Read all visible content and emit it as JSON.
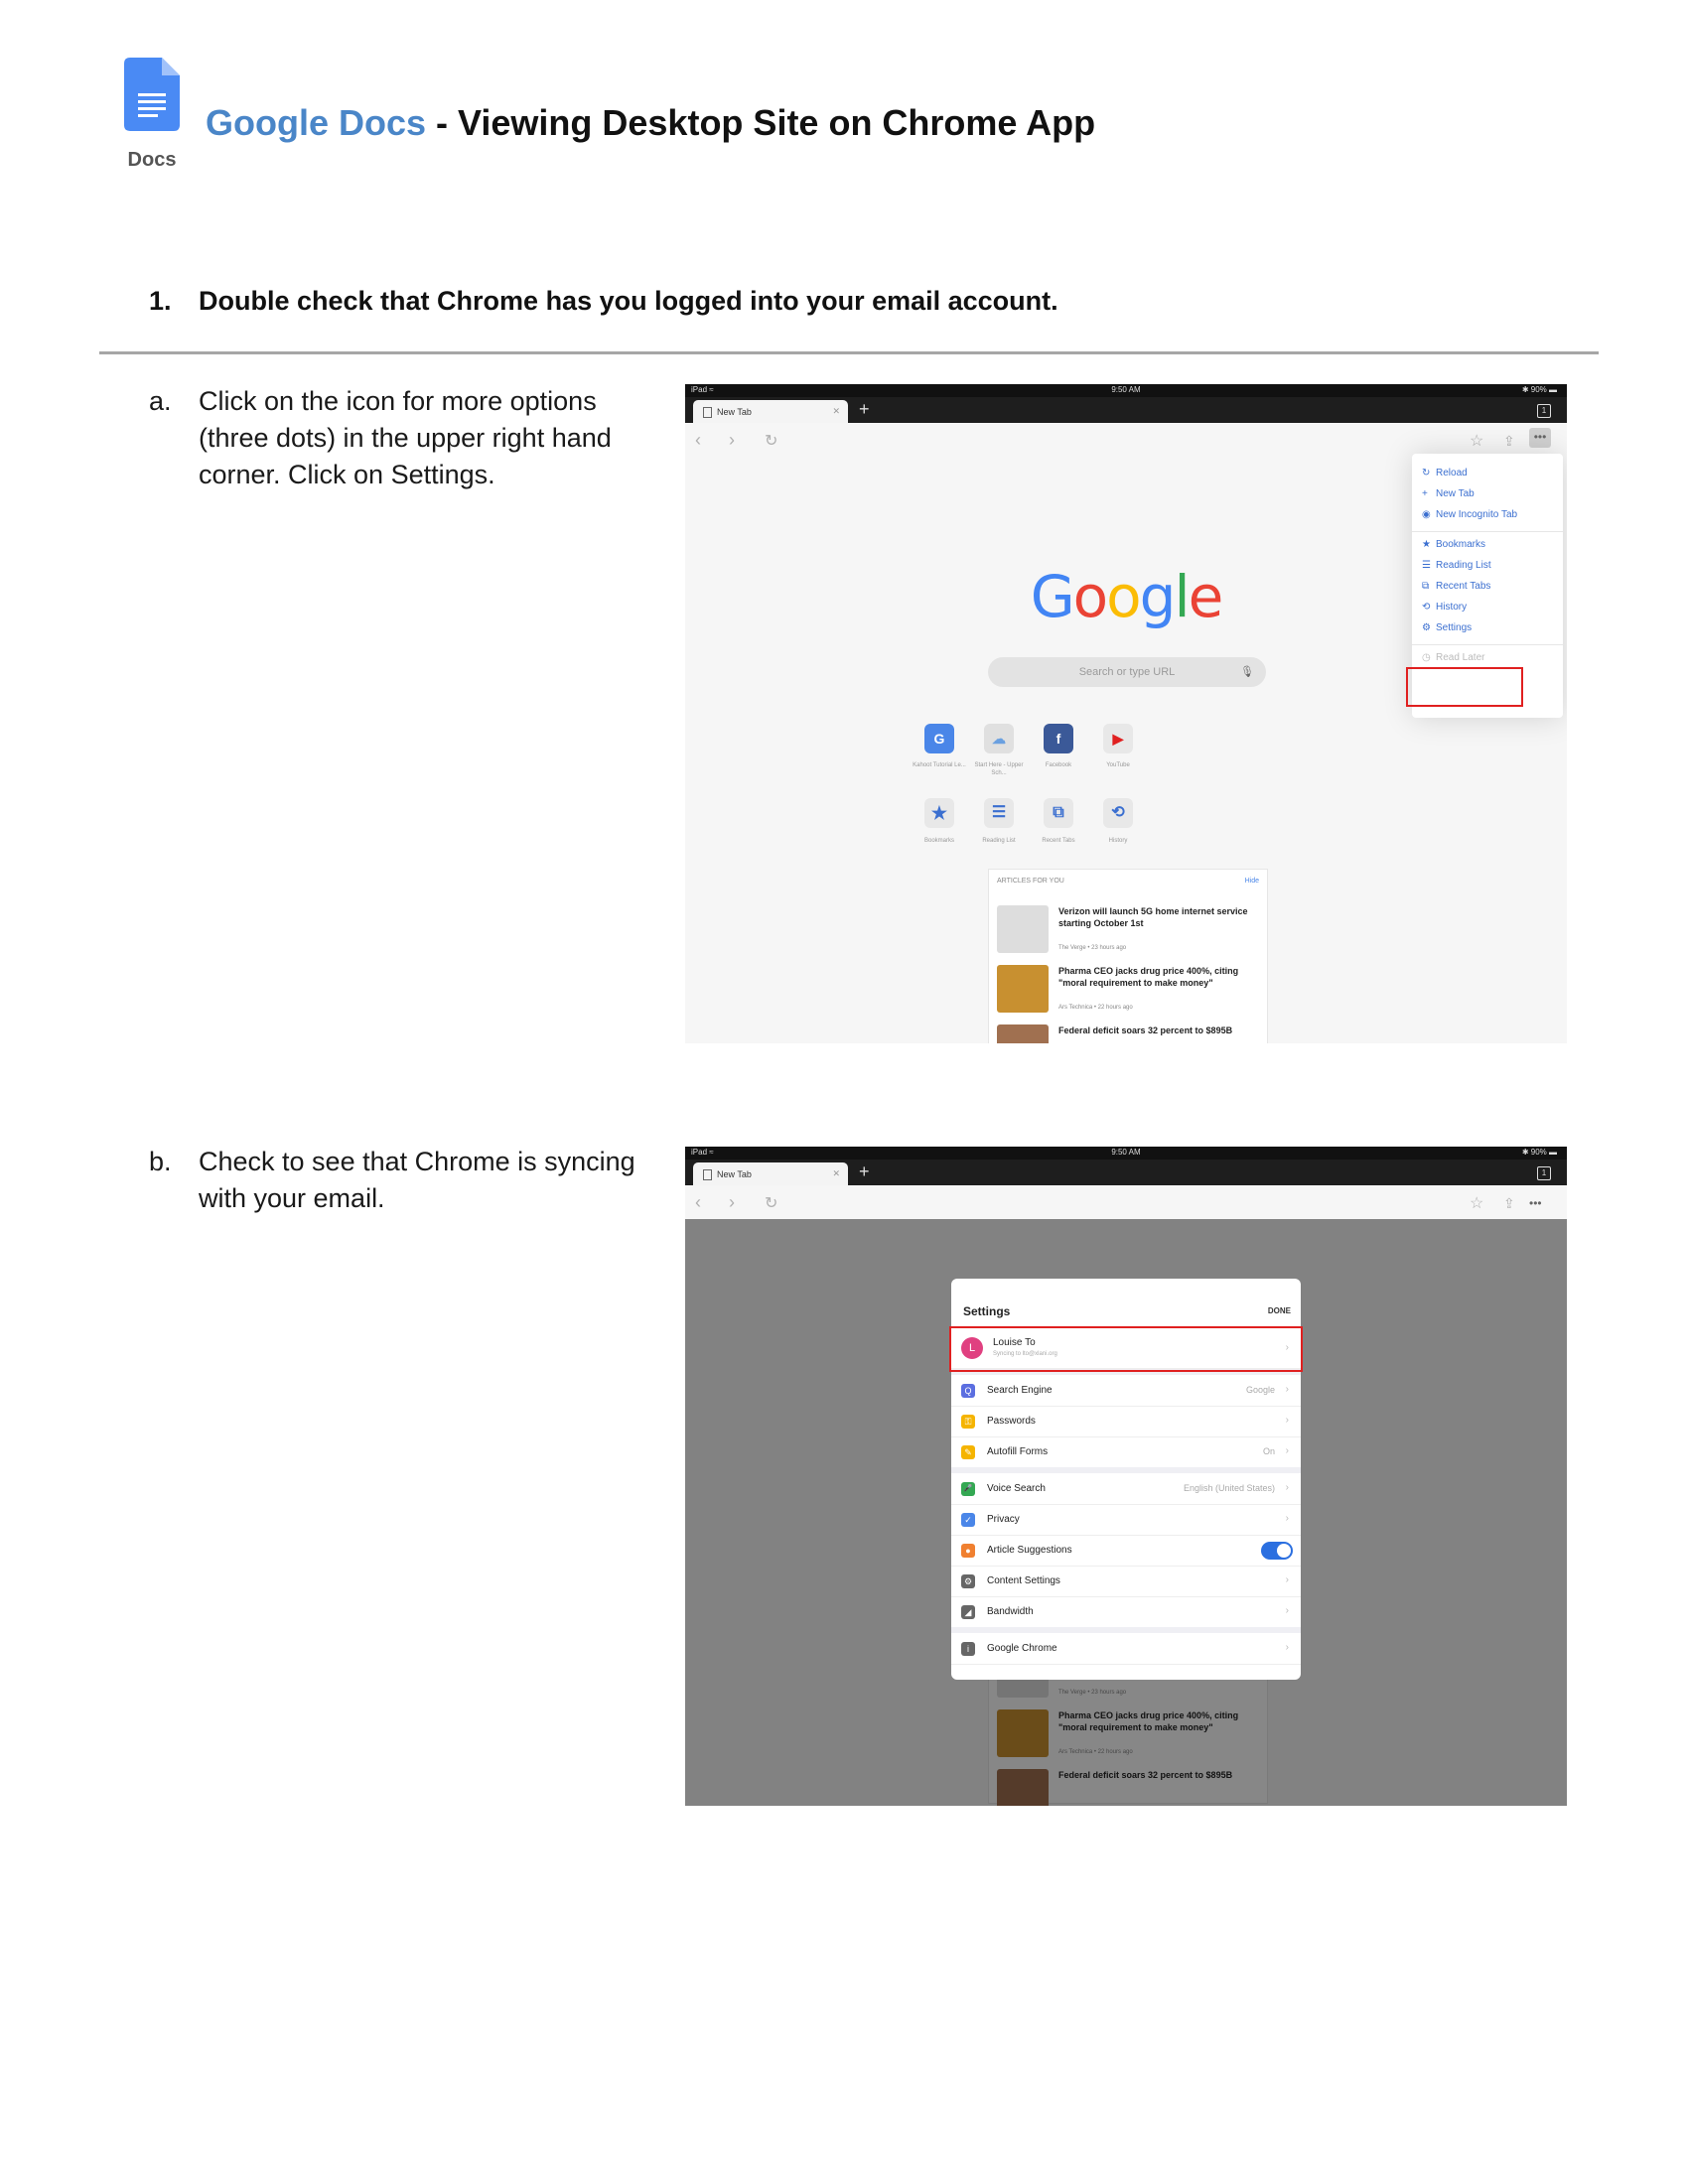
{
  "header": {
    "logo_label": "Docs",
    "title_brand": "Google Docs",
    "title_rest": " - Viewing Desktop Site on Chrome App"
  },
  "step1": {
    "number": "1.",
    "text": "Double check that Chrome has you logged into your email account."
  },
  "substeps": [
    {
      "label": "a.",
      "text": "Click on the icon for more options (three dots) in the upper right hand corner. Click on Settings."
    },
    {
      "label": "b.",
      "text": "Check to see that Chrome is syncing with your email."
    }
  ],
  "screenshot1": {
    "status_left": "iPad ≈",
    "status_time": "9:50 AM",
    "status_right": "✱ 90% ▬",
    "tab_title": "New Tab",
    "tab_count": "1",
    "google_letters": [
      {
        "ch": "G",
        "color": "#4285f4"
      },
      {
        "ch": "o",
        "color": "#ea4335"
      },
      {
        "ch": "o",
        "color": "#fbbc05"
      },
      {
        "ch": "g",
        "color": "#4285f4"
      },
      {
        "ch": "l",
        "color": "#34a853"
      },
      {
        "ch": "e",
        "color": "#ea4335"
      }
    ],
    "omnibox_placeholder": "Search or type URL",
    "shortcuts": [
      {
        "icon": "G",
        "label": "Kahoot Tutorial Le...",
        "color": "#4a86e8"
      },
      {
        "icon": "☁",
        "label": "Start Here - Upper Sch...",
        "color": "#6aa0e0"
      },
      {
        "icon": "f",
        "label": "Facebook",
        "color": "#3b5998"
      },
      {
        "icon": "▶",
        "label": "YouTube",
        "color": "#e02020"
      }
    ],
    "quick_links": [
      {
        "icon": "★",
        "label": "Bookmarks"
      },
      {
        "icon": "☰",
        "label": "Reading List"
      },
      {
        "icon": "⧉",
        "label": "Recent Tabs"
      },
      {
        "icon": "⟲",
        "label": "History"
      }
    ],
    "articles_header": "ARTICLES FOR YOU",
    "articles_hide": "Hide",
    "articles": [
      {
        "title": "Verizon will launch 5G home internet service starting October 1st",
        "source": "The Verge • 23 hours ago"
      },
      {
        "title": "Pharma CEO jacks drug price 400%, citing \"moral requirement to make money\"",
        "source": "Ars Technica • 22 hours ago"
      },
      {
        "title": "Federal deficit soars 32 percent to $895B",
        "source": ""
      }
    ],
    "menu_items": [
      {
        "icon": "↻",
        "label": "Reload"
      },
      {
        "icon": "+",
        "label": "New Tab"
      },
      {
        "icon": "◉",
        "label": "New Incognito Tab"
      },
      {
        "icon": "★",
        "label": "Bookmarks"
      },
      {
        "icon": "☰",
        "label": "Reading List"
      },
      {
        "icon": "⧉",
        "label": "Recent Tabs"
      },
      {
        "icon": "⟲",
        "label": "History"
      },
      {
        "icon": "⚙",
        "label": "Settings"
      },
      {
        "icon": "◷",
        "label": "Read Later"
      }
    ]
  },
  "screenshot2": {
    "settings_title": "Settings",
    "done_label": "DONE",
    "account_initial": "L",
    "account_name": "Louise To",
    "account_sub": "Syncing to lto@xlani.org",
    "rows": [
      {
        "icon": "Q",
        "label": "Search Engine",
        "value": "Google",
        "color": "#5b6ee0"
      },
      {
        "icon": "⚿",
        "label": "Passwords",
        "value": "",
        "color": "#f5b400"
      },
      {
        "icon": "✎",
        "label": "Autofill Forms",
        "value": "On",
        "color": "#f5b400"
      },
      {
        "icon": "🎤",
        "label": "Voice Search",
        "value": "English (United States)",
        "color": "#34a853"
      },
      {
        "icon": "✓",
        "label": "Privacy",
        "value": "",
        "color": "#4a86e8"
      },
      {
        "icon": "●",
        "label": "Article Suggestions",
        "value": "",
        "color": "#f08030"
      },
      {
        "icon": "⚙",
        "label": "Content Settings",
        "value": "",
        "color": "#666"
      },
      {
        "icon": "◢",
        "label": "Bandwidth",
        "value": "",
        "color": "#666"
      },
      {
        "icon": "i",
        "label": "Google Chrome",
        "value": "",
        "color": "#666"
      }
    ]
  }
}
